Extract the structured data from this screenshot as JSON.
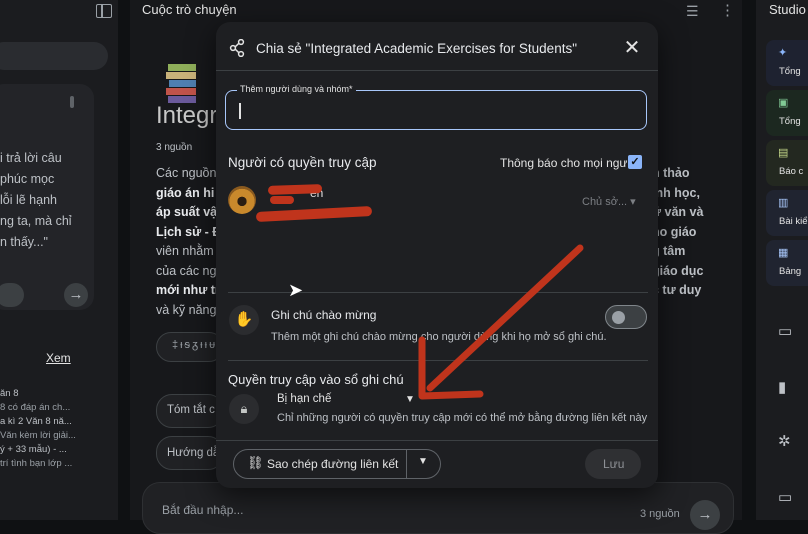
{
  "app": {
    "left_panel": {
      "card_lines": [
        "i trả lời câu",
        "",
        "phúc mọc",
        "lỗi lẽ hạnh",
        "ng ta, mà chỉ",
        "n thấy...\""
      ],
      "see_more": "Xem",
      "list": [
        {
          "title": "ăn 8",
          "sub": "8 có đáp án ch..."
        },
        {
          "title": "a kì 2 Văn 8 nă...",
          "sub": "Văn kèm lời giải..."
        },
        {
          "title": "ý + 33 mẫu) - ...",
          "sub": "trí tình bạn lớp ..."
        }
      ]
    },
    "conversation": {
      "title": "Cuộc trò chuyện",
      "notebook_title": "Integr",
      "sources": "3 nguồn",
      "summary_lines": [
        "Các nguồn",
        "giáo án hi",
        "áp suất vậ",
        "Lịch sử - Đ",
        "viên nhằm",
        "của các ng",
        "mới như tr",
        "và kỹ năng"
      ],
      "summary_right": [
        "n thảo",
        "inh học,",
        "ữ văn và",
        "ho giáo",
        "g tâm",
        "giáo dục",
        "c tư duy"
      ],
      "chip_1": "‡ᵻᵴᵹᵻᵼᵾ",
      "chip_2": "Tóm tắt c",
      "chip_3": "Hướng dẫ",
      "input_placeholder": "Bắt đầu nhập...",
      "input_count": "3 nguồn"
    },
    "studio": {
      "title": "Studio",
      "tiles": [
        {
          "label": "Tổng",
          "color": "#1e2230"
        },
        {
          "label": "Tổng",
          "color": "#1c2820"
        },
        {
          "label": "Báo c",
          "color": "#232820"
        },
        {
          "label": "Bài kiể",
          "color": "#202430"
        },
        {
          "label": "Bảng",
          "color": "#202430"
        }
      ]
    }
  },
  "dialog": {
    "title": "Chia sẻ \"Integrated Academic Exercises for Students\"",
    "add_people_label": "Thêm người dùng và nhóm*",
    "add_people_value": "",
    "access_heading": "Người có quyền truy cập",
    "notify_label": "Thông báo cho mọi người",
    "notify_checked": true,
    "user_name_fragment": "ễn",
    "user_role": "Chủ sở...",
    "welcome_title": "Ghi chú chào mừng",
    "welcome_desc": "Thêm một ghi chú chào mừng cho người dùng khi họ mở sổ ghi chú.",
    "welcome_enabled": false,
    "notebook_access_title": "Quyền truy cập vào sổ ghi chú",
    "restriction_value": "Bị hạn chế",
    "restriction_desc": "Chỉ những người có quyền truy cập mới có thể mở bằng đường liên kết này",
    "copy_link_label": "Sao chép đường liên kết",
    "save_label": "Lưu"
  },
  "colors": {
    "accent": "#a8c7fa",
    "checkbox": "#8ab4f8",
    "annotation": "#c0341c"
  }
}
